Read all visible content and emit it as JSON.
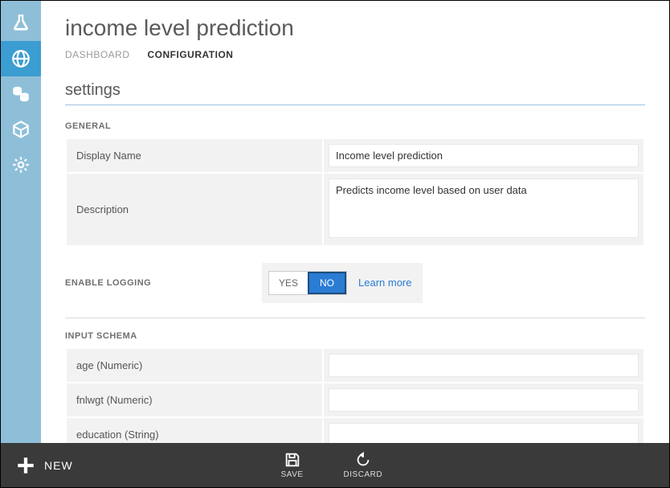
{
  "page": {
    "title": "income level prediction",
    "tabs": [
      {
        "label": "DASHBOARD",
        "active": false
      },
      {
        "label": "CONFIGURATION",
        "active": true
      }
    ],
    "section_heading": "settings"
  },
  "general": {
    "heading": "GENERAL",
    "display_name_label": "Display Name",
    "display_name_value": "Income level prediction",
    "description_label": "Description",
    "description_value": "Predicts income level based on user data"
  },
  "logging": {
    "heading": "ENABLE LOGGING",
    "yes": "YES",
    "no": "NO",
    "selected": "NO",
    "learn_more": "Learn more"
  },
  "input_schema": {
    "heading": "INPUT SCHEMA",
    "rows": [
      {
        "label": "age (Numeric)",
        "value": ""
      },
      {
        "label": "fnlwgt (Numeric)",
        "value": ""
      },
      {
        "label": "education (String)",
        "value": ""
      }
    ]
  },
  "footer": {
    "new": "NEW",
    "save": "SAVE",
    "discard": "DISCARD"
  }
}
